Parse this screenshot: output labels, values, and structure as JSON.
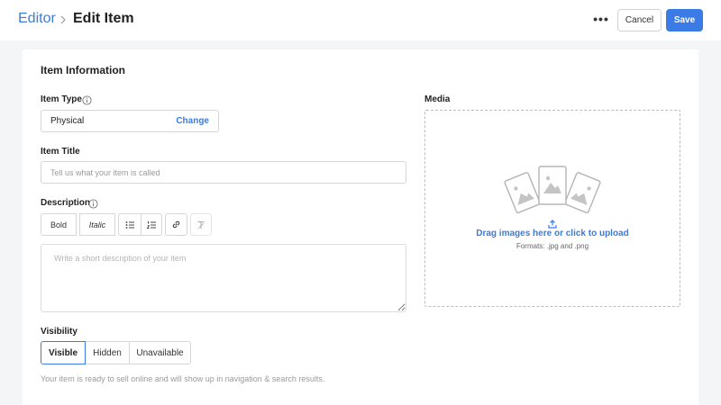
{
  "header": {
    "breadcrumb_root": "Editor",
    "page_title": "Edit Item",
    "more_label": "•••",
    "cancel_label": "Cancel",
    "save_label": "Save"
  },
  "colors": {
    "accent": "#3b7be6",
    "link": "#3d7bd9",
    "page_bg": "#f4f5f6",
    "card_bg": "#ffffff"
  },
  "form": {
    "section_title": "Item Information",
    "item_type": {
      "label": "Item Type",
      "value": "Physical",
      "change_label": "Change",
      "icon": "info-icon"
    },
    "item_title": {
      "label": "Item Title",
      "placeholder": "Tell us what your item is called",
      "value": ""
    },
    "description": {
      "label": "Description",
      "icon": "info-icon",
      "placeholder": "Write a short description of your item",
      "value": "",
      "toolbar": {
        "bold": "Bold",
        "italic": "Italic",
        "bullets_icon": "bulleted-list-icon",
        "numbered_icon": "numbered-list-icon",
        "link_icon": "link-icon",
        "clear_icon": "clear-format-icon"
      }
    },
    "visibility": {
      "label": "Visibility",
      "options": [
        "Visible",
        "Hidden",
        "Unavailable"
      ],
      "selected": "Visible",
      "help_text": "Your item is ready to sell online and will show up in navigation & search results."
    }
  },
  "media": {
    "label": "Media",
    "cta": "Drag images here or click to upload",
    "formats": "Formats: .jpg and .png",
    "icon": "upload-icon"
  }
}
